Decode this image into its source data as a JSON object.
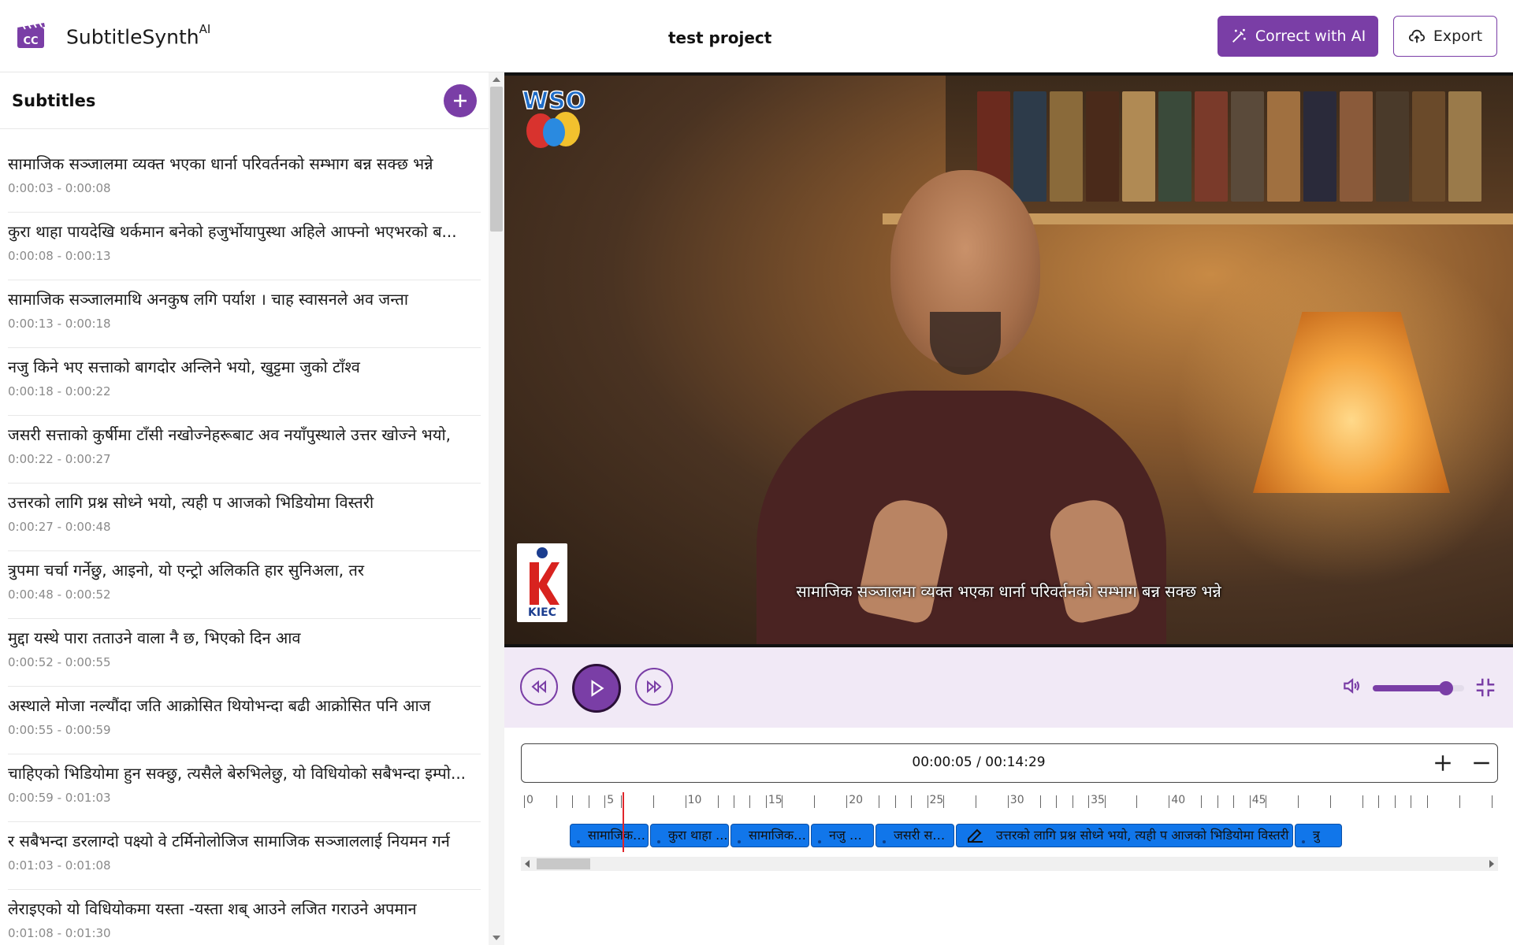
{
  "header": {
    "app_name": "SubtitleSynth",
    "app_name_sup": "AI",
    "project_title": "test project",
    "correct_ai_label": "Correct with AI",
    "export_label": "Export",
    "accent_color": "#7a3ea6"
  },
  "sidebar": {
    "title": "Subtitles",
    "items": [
      {
        "text": "सामाजिक सञ्जालमा व्यक्त भएका धार्ना परिवर्तनको सम्भाग बन्न सक्छ भन्ने",
        "time": "0:00:03 - 0:00:08"
      },
      {
        "text": "कुरा थाहा पायदेखि थर्कमान बनेको हजुर्भोयापुस्था अहिले आफ्नो भएभरको ब...",
        "time": "0:00:08 - 0:00:13"
      },
      {
        "text": "सामाजिक सञ्जालमाथि अनकुष लगि पर्याश । चाह स्वासनले अव जन्ता",
        "time": "0:00:13 - 0:00:18"
      },
      {
        "text": "नजु किने भए सत्ताको बागदोर अन्लिने भयो, खुट्टमा जुको टाँश्व",
        "time": "0:00:18 - 0:00:22"
      },
      {
        "text": "जसरी सत्ताको कुर्षीमा टाँसी नखोज्नेहरूबाट अव नयाँपुस्थाले उत्तर खोज्ने भयो,",
        "time": "0:00:22 - 0:00:27"
      },
      {
        "text": "उत्तरको लागि प्रश्न सोध्ने भयो, त्यही प आजको भिडियोमा विस्तरी",
        "time": "0:00:27 - 0:00:48"
      },
      {
        "text": "त्रुपमा चर्चा गर्नेछु, आइनो, यो एन्ट्रो अलिकति हार सुनिअला, तर",
        "time": "0:00:48 - 0:00:52"
      },
      {
        "text": "मुद्दा यस्थे पारा तताउने वाला नै छ, भिएको दिन आव",
        "time": "0:00:52 - 0:00:55"
      },
      {
        "text": "अस्थाले मोजा नल्यौंदा जति आक्रोसित थियोभन्दा बढी आक्रोसित पनि आज",
        "time": "0:00:55 - 0:00:59"
      },
      {
        "text": "चाहिएको भिडियोमा हुन सक्छु, त्यसैले बेरुभिलेछु, यो विधियोको सबैभन्दा इम्पो...",
        "time": "0:00:59 - 0:01:03"
      },
      {
        "text": "र सबैभन्दा डरलाग्दो पक्ष्यो वे टर्मिनोलोजिज सामाजिक सञ्जाललाई नियमन गर्न",
        "time": "0:01:03 - 0:01:08"
      },
      {
        "text": "लेराइएको यो विधियोकमा यस्ता -यस्ता शब् आउने लजित गराउने अपमान",
        "time": "0:01:08 - 0:01:30"
      }
    ]
  },
  "video": {
    "caption": "सामाजिक सञ्जालमा व्यक्त भएका धार्ना परिवर्तनको सम्भाग बन्न सक्छ भन्ने",
    "logo_top_text": "WSO",
    "logo_bottom_text": "KIEC"
  },
  "controls": {
    "volume_level": 0.8
  },
  "timeline": {
    "time_display": "00:00:05 / 00:14:29",
    "ruler_labels": [
      "0",
      "5",
      "10",
      "15",
      "20",
      "25",
      "30",
      "35",
      "40",
      "45"
    ],
    "clips": [
      {
        "label": "सामाजिक ..."
      },
      {
        "label": "कुरा थाहा ..."
      },
      {
        "label": "सामाजिक ..."
      },
      {
        "label": "नजु कि..."
      },
      {
        "label": "जसरी सत्ता..."
      },
      {
        "label": "उत्तरको लागि प्रश्न सोध्ने भयो, त्यही प आजको भिडियोमा विस्तरी"
      },
      {
        "label": "त्रु"
      }
    ],
    "clip_color": "#1176ea",
    "playhead_color": "#e0262b"
  }
}
